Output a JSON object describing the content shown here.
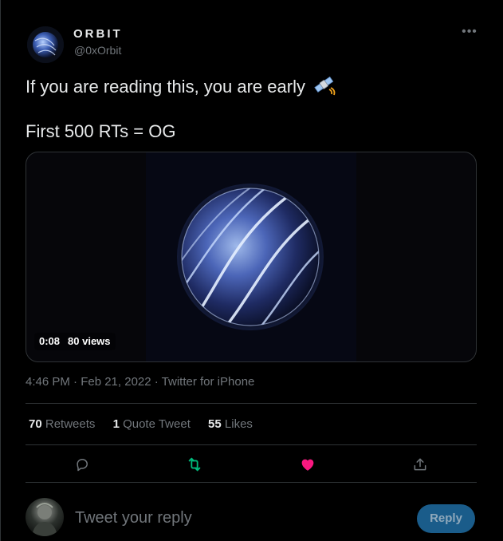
{
  "author": {
    "name": "ORBIT",
    "handle": "@0xOrbit"
  },
  "tweet": {
    "line1": "If you are reading this, you are early",
    "line1_emoji": "satellite-icon",
    "line2": "First 500 RTs = OG"
  },
  "media": {
    "duration": "0:08",
    "views": "80 views"
  },
  "meta": {
    "timestamp": "4:46 PM · Feb 21, 2022 · Twitter for iPhone"
  },
  "stats": {
    "retweets_count": "70",
    "retweets_label": "Retweets",
    "quotes_count": "1",
    "quotes_label": "Quote Tweet",
    "likes_count": "55",
    "likes_label": "Likes"
  },
  "actions": {
    "icons": [
      "reply-icon",
      "retweet-icon",
      "like-icon",
      "share-icon"
    ],
    "retweet_color": "#00ba7c",
    "like_color": "#f91880"
  },
  "reply": {
    "placeholder": "Tweet your reply",
    "button_label": "Reply"
  },
  "colors": {
    "background": "#000000",
    "text": "#e7e9ea",
    "muted": "#71767b",
    "border": "#2f3336",
    "accent": "#1d9bf0"
  }
}
